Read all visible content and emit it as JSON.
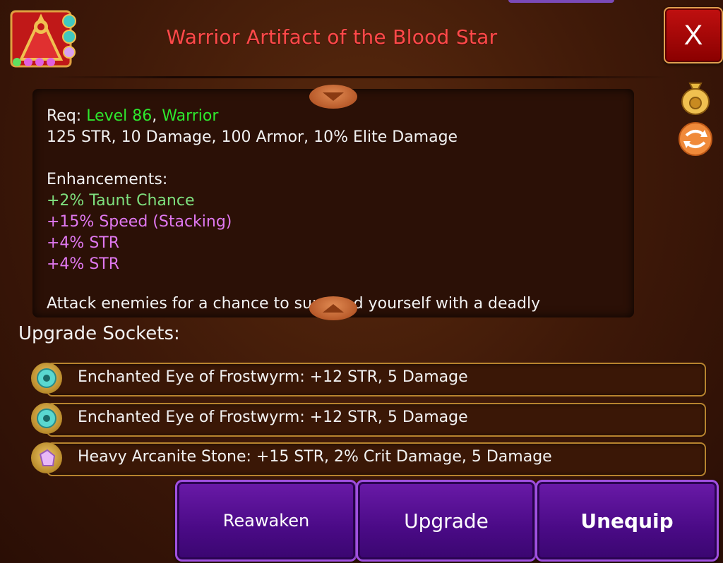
{
  "item": {
    "title": "Warrior Artifact of the Blood Star",
    "req_prefix": "Req: ",
    "req_level": "Level 86",
    "req_sep": ", ",
    "req_class": "Warrior",
    "stats": "125 STR, 10 Damage, 100 Armor, 10% Elite Damage",
    "enhancements_label": "Enhancements:",
    "enhancements": [
      "+2% Taunt Chance",
      "+15% Speed (Stacking)",
      "+4% STR",
      "+4% STR"
    ],
    "flavor_cut": "Attack enemies for a chance to surround yourself with a deadly"
  },
  "close_label": "X",
  "sockets": {
    "heading": "Upgrade Sockets:",
    "items": [
      {
        "text": "Enchanted Eye of Frostwyrm: +12 STR, 5 Damage",
        "icon": "frost-eye-gem-icon"
      },
      {
        "text": "Enchanted Eye of Frostwyrm: +12 STR, 5 Damage",
        "icon": "frost-eye-gem-icon"
      },
      {
        "text": "Heavy Arcanite Stone: +15 STR, 2% Crit Damage, 5 Damage",
        "icon": "arcanite-stone-icon"
      }
    ]
  },
  "buttons": {
    "reawaken": "Reawaken",
    "upgrade": "Upgrade",
    "unequip": "Unequip"
  },
  "colors": {
    "title": "#ff4a4a",
    "requirement": "#2ee82e",
    "enhancement_green": "#7ee07e",
    "enhancement_purple": "#e078f0",
    "button": "#4a0a86"
  }
}
